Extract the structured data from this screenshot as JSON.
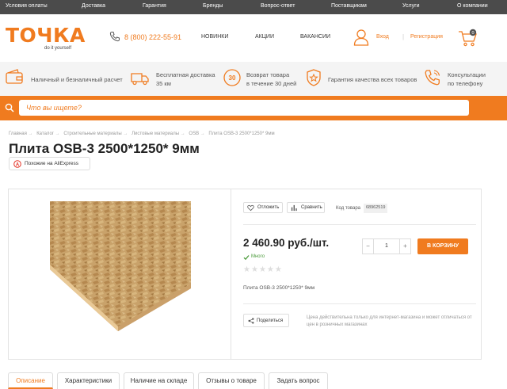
{
  "topnav": [
    "Условия оплаты",
    "Доставка",
    "Гарантия",
    "Бренды",
    "Вопрос-ответ",
    "Поставщикам",
    "Услуги",
    "О компании"
  ],
  "header": {
    "logo": "ТОЧКА",
    "logo_sub": "do it yourself",
    "phone": "8 (800) 222-55-91",
    "nav": [
      "НОВИНКИ",
      "АКЦИИ",
      "ВАКАНСИИ"
    ],
    "login": "Вход",
    "register": "Регистрация",
    "cart_count": "0"
  },
  "benefits": [
    {
      "icon": "wallet-icon",
      "lines": [
        "Наличный и безналичный расчет"
      ]
    },
    {
      "icon": "truck-icon",
      "lines": [
        "Бесплатная доставка",
        "35 км"
      ]
    },
    {
      "icon": "return-30-icon",
      "lines": [
        "Возврат товара",
        "в течение 30 дней"
      ]
    },
    {
      "icon": "quality-badge-icon",
      "lines": [
        "Гарантия качества всех товаров"
      ]
    },
    {
      "icon": "phone-consult-icon",
      "lines": [
        "Консультации",
        "по телефону"
      ]
    }
  ],
  "search": {
    "placeholder": "Что вы ищете?"
  },
  "breadcrumb": [
    "Главная",
    "Каталог",
    "Строительные материалы",
    "Листовые материалы",
    "OSB",
    "Плита OSB-3 2500*1250* 9мм"
  ],
  "product": {
    "title": "Плита OSB-3 2500*1250* 9мм",
    "aliexpress": "Похожие на AliExpress",
    "postpone": "Отложить",
    "compare": "Сравнить",
    "code_label": "Код товара",
    "code": "68962519",
    "price": "2 460.90 руб./шт.",
    "stock": "Много",
    "rating": 0,
    "rating_max": 5,
    "description": "Плита OSB-3 2500*1250* 9мм",
    "quantity": "1",
    "cart_button": "В КОРЗИНУ",
    "share": "Поделиться",
    "note": "Цена действительна только для интернет-магазина и может отличаться от цен в розничных магазинах"
  },
  "tabs": [
    "Описание",
    "Характеристики",
    "Наличие на складе",
    "Отзывы о товаре",
    "Задать вопрос"
  ],
  "colors": {
    "accent": "#f07b1f",
    "topbar": "#4b4b4b",
    "in_stock": "#4a9b3a"
  }
}
